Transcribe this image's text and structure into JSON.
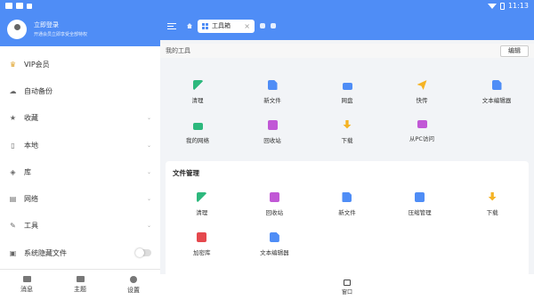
{
  "statusbar": {
    "time": "11:13"
  },
  "profile": {
    "name": "立即登录",
    "subtitle": "开通会员立即享受全部特权"
  },
  "menu": [
    {
      "label": "VIP会员",
      "icon": "vip-icon",
      "chevron": false
    },
    {
      "label": "自动备份",
      "icon": "cloud-backup-icon",
      "chevron": false
    },
    {
      "label": "收藏",
      "icon": "star-icon",
      "chevron": true
    },
    {
      "label": "本地",
      "icon": "phone-icon",
      "chevron": true
    },
    {
      "label": "库",
      "icon": "library-icon",
      "chevron": true
    },
    {
      "label": "网络",
      "icon": "network-icon",
      "chevron": true
    },
    {
      "label": "工具",
      "icon": "wrench-icon",
      "chevron": true
    },
    {
      "label": "系统隐藏文件",
      "icon": "hidden-file-icon",
      "chevron": false
    }
  ],
  "bottom_nav": [
    {
      "label": "消息",
      "icon": "message-icon"
    },
    {
      "label": "主题",
      "icon": "theme-icon"
    },
    {
      "label": "设置",
      "icon": "settings-icon"
    }
  ],
  "topbar": {
    "tab_label": "工具箱"
  },
  "my_tools": {
    "label": "我的工具",
    "edit_label": "编辑",
    "items": [
      {
        "label": "清理",
        "icon": "broom-icon"
      },
      {
        "label": "新文件",
        "icon": "new-file-icon"
      },
      {
        "label": "网盘",
        "icon": "cloud-drive-icon"
      },
      {
        "label": "快传",
        "icon": "paper-plane-icon"
      },
      {
        "label": "文本编辑器",
        "icon": "text-editor-icon"
      },
      {
        "label": "我的网络",
        "icon": "my-network-icon"
      },
      {
        "label": "回收站",
        "icon": "recycle-bin-icon"
      },
      {
        "label": "下载",
        "icon": "download-icon"
      },
      {
        "label": "从PC访问",
        "icon": "pc-access-icon"
      }
    ]
  },
  "file_management": {
    "title": "文件管理",
    "items": [
      {
        "label": "清理",
        "icon": "broom-icon"
      },
      {
        "label": "回收站",
        "icon": "recycle-bin-icon"
      },
      {
        "label": "新文件",
        "icon": "new-file-icon"
      },
      {
        "label": "压缩管理",
        "icon": "zip-icon"
      },
      {
        "label": "下载",
        "icon": "download-icon"
      },
      {
        "label": "加密库",
        "icon": "encrypted-vault-icon"
      },
      {
        "label": "文本编辑器",
        "icon": "text-editor-icon"
      }
    ]
  },
  "window_bar": {
    "label": "窗口"
  },
  "colors": {
    "accent": "#4f8df6"
  }
}
